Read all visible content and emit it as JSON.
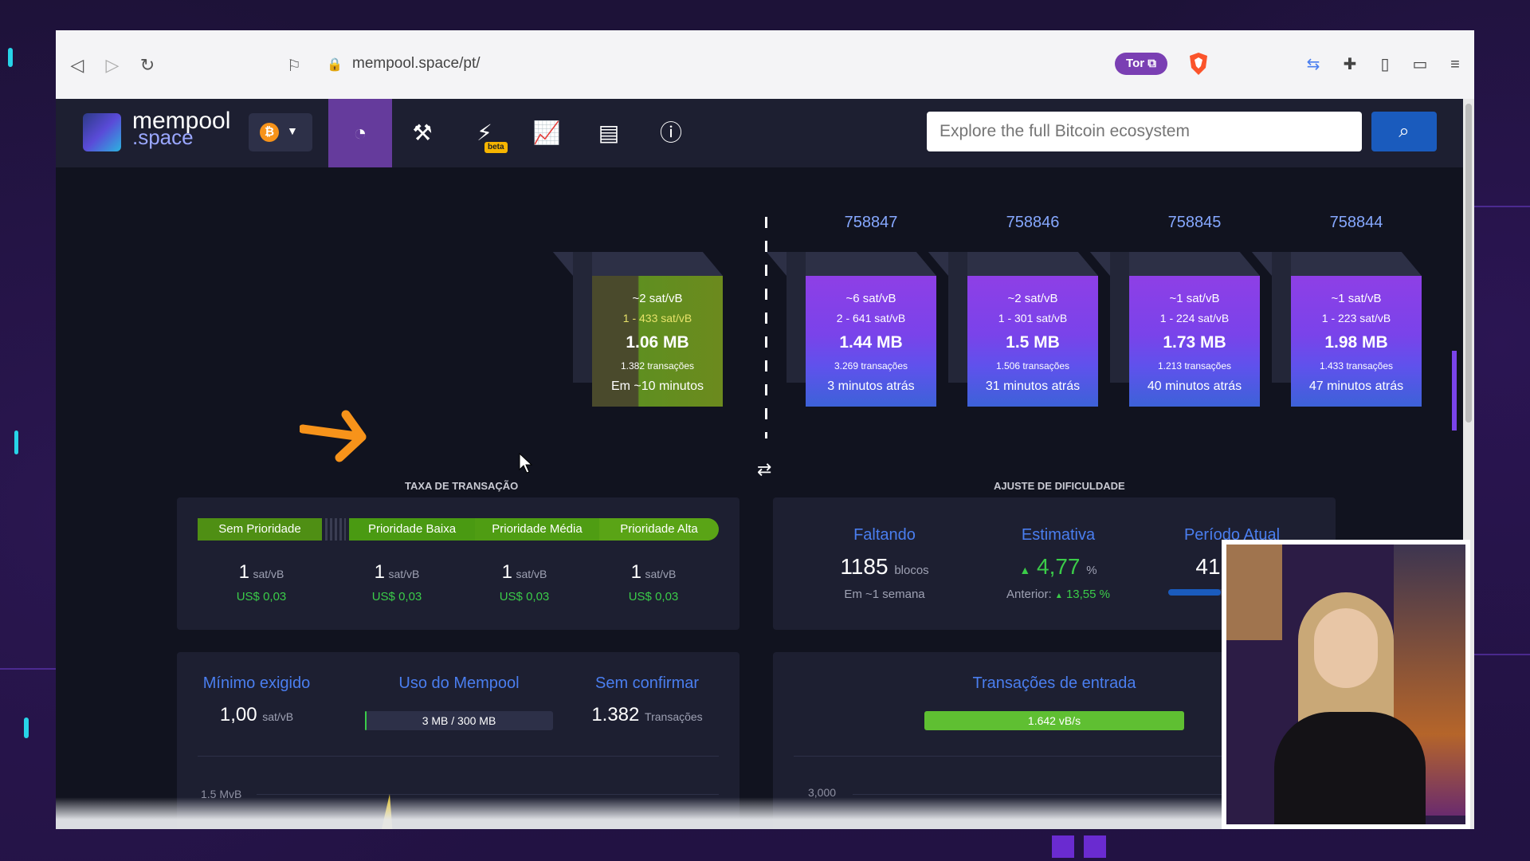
{
  "browser": {
    "url": "mempool.space/pt/",
    "tor_label": "Tor"
  },
  "app": {
    "logo_line1": "mempool",
    "logo_line2": ".space",
    "network_symbol": "₿",
    "search_placeholder": "Explore the full Bitcoin ecosystem",
    "beta_label": "beta",
    "nav_items": [
      "dashboard-icon",
      "hammer-icon",
      "lightning-icon",
      "graphs-icon",
      "docs-icon",
      "about-icon"
    ]
  },
  "blocks": {
    "pending": {
      "median_fee": "~2 sat/vB",
      "fee_range": "1 - 433 sat/vB",
      "size": "1.06 MB",
      "tx_count": "1.382 transações",
      "eta": "Em ~10 minutos"
    },
    "mined": [
      {
        "height": "758847",
        "median_fee": "~6 sat/vB",
        "fee_range": "2 - 641 sat/vB",
        "size": "1.44 MB",
        "tx_count": "3.269 transações",
        "age": "3 minutos atrás"
      },
      {
        "height": "758846",
        "median_fee": "~2 sat/vB",
        "fee_range": "1 - 301 sat/vB",
        "size": "1.5 MB",
        "tx_count": "1.506 transações",
        "age": "31 minutos atrás"
      },
      {
        "height": "758845",
        "median_fee": "~1 sat/vB",
        "fee_range": "1 - 224 sat/vB",
        "size": "1.73 MB",
        "tx_count": "1.213 transações",
        "age": "40 minutos atrás"
      },
      {
        "height": "758844",
        "median_fee": "~1 sat/vB",
        "fee_range": "1 - 223 sat/vB",
        "size": "1.98 MB",
        "tx_count": "1.433 transações",
        "age": "47 minutos atrás"
      }
    ]
  },
  "fees": {
    "title": "TAXA DE TRANSAÇÃO",
    "levels": [
      {
        "label": "Sem Prioridade",
        "value": "1",
        "unit": "sat/vB",
        "usd": "US$ 0,03"
      },
      {
        "label": "Prioridade Baixa",
        "value": "1",
        "unit": "sat/vB",
        "usd": "US$ 0,03"
      },
      {
        "label": "Prioridade Média",
        "value": "1",
        "unit": "sat/vB",
        "usd": "US$ 0,03"
      },
      {
        "label": "Prioridade Alta",
        "value": "1",
        "unit": "sat/vB",
        "usd": "US$ 0,03"
      }
    ]
  },
  "difficulty": {
    "title": "AJUSTE DE DIFICULDADE",
    "remaining_label": "Faltando",
    "remaining_value": "1185",
    "remaining_unit": "blocos",
    "remaining_sub": "Em ~1 semana",
    "estimate_label": "Estimativa",
    "estimate_value": "4,77",
    "estimate_unit": "%",
    "estimate_prev": "Anterior:",
    "estimate_prev_value": "13,55 %",
    "period_label": "Período Atual",
    "period_value": "41,22",
    "period_unit": "%"
  },
  "mempool_stats": {
    "min_fee_label": "Mínimo exigido",
    "min_fee_value": "1,00",
    "min_fee_unit": "sat/vB",
    "usage_label": "Uso do Mempool",
    "usage_value": "3 MB / 300 MB",
    "usage_fraction": 0.01,
    "unconfirmed_label": "Sem confirmar",
    "unconfirmed_value": "1.382",
    "unconfirmed_unit": "Transações",
    "chart_axis_label": "1.5 MvB"
  },
  "incoming": {
    "label": "Transações de entrada",
    "rate": "1.642 vB/s",
    "chart_axis_label": "3,000"
  },
  "colors": {
    "accent_purple": "#653b9c",
    "fee_green": "#3bcc49",
    "label_blue": "#4a7eef",
    "block_purple": "#8e3fe6",
    "arrow_orange": "#f7931a"
  }
}
